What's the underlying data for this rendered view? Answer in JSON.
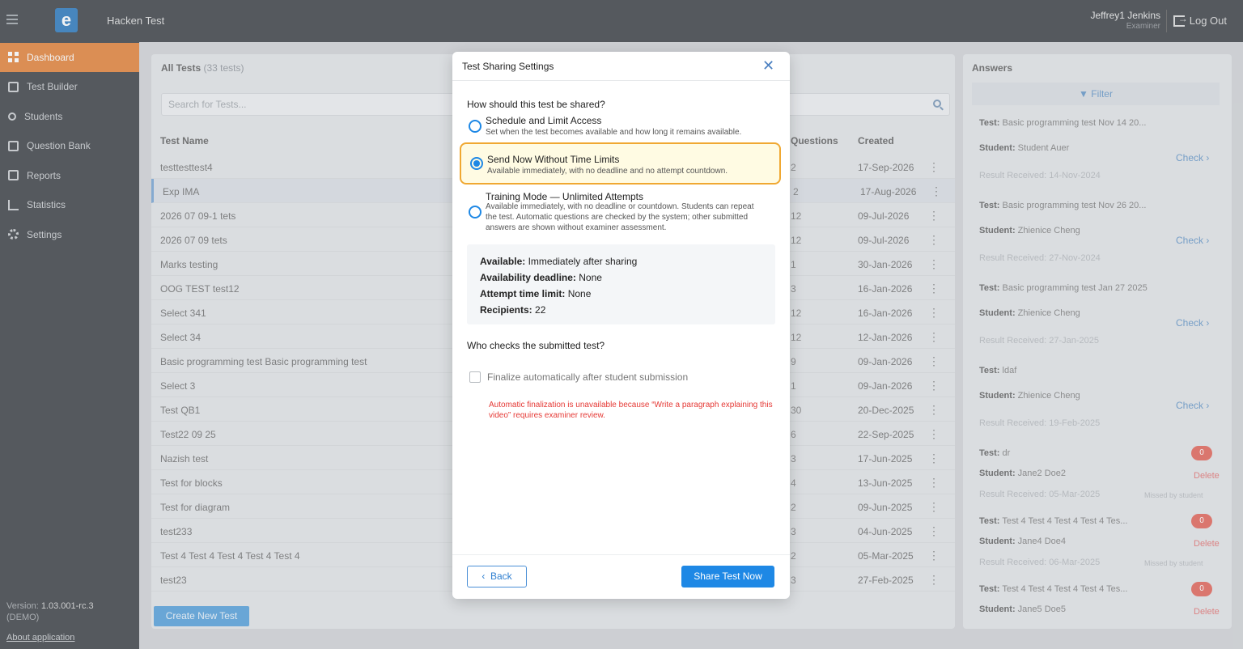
{
  "topbar": {
    "app_title": "Hacken Test",
    "logo_glyph": "e",
    "user_name": "Jeffrey1 Jenkins",
    "user_role": "Examiner",
    "logout_label": "Log Out"
  },
  "sidebar": {
    "items": [
      {
        "label": "Dashboard",
        "icon": "dashboard-icon"
      },
      {
        "label": "Test Builder",
        "icon": "builder-icon"
      },
      {
        "label": "Students",
        "icon": "students-icon"
      },
      {
        "label": "Question Bank",
        "icon": "question-bank-icon"
      },
      {
        "label": "Reports",
        "icon": "reports-icon"
      },
      {
        "label": "Statistics",
        "icon": "statistics-icon"
      },
      {
        "label": "Settings",
        "icon": "settings-icon"
      }
    ],
    "version_label": "Version:",
    "version": "1.03.001-rc.3",
    "env": "(DEMO)",
    "about": "About application"
  },
  "tests": {
    "title": "All Tests",
    "count": "(33 tests)",
    "search_placeholder": "Search for Tests...",
    "columns": {
      "name": "Test Name",
      "questions": "Questions",
      "created": "Created"
    },
    "rows": [
      {
        "name": "testtesttest4",
        "q": "2",
        "created": "17-Sep-2026"
      },
      {
        "name": "Exp IMA",
        "q": "2",
        "created": "17-Aug-2026"
      },
      {
        "name": "2026 07 09-1 tets",
        "q": "12",
        "created": "09-Jul-2026"
      },
      {
        "name": "2026 07 09 tets",
        "q": "12",
        "created": "09-Jul-2026"
      },
      {
        "name": "Marks testing",
        "q": "1",
        "created": "30-Jan-2026"
      },
      {
        "name": "OOG TEST test12",
        "q": "3",
        "created": "16-Jan-2026"
      },
      {
        "name": "Select 341",
        "q": "12",
        "created": "16-Jan-2026"
      },
      {
        "name": "Select 34",
        "q": "12",
        "created": "12-Jan-2026"
      },
      {
        "name": "Basic programming test Basic programming test",
        "q": "9",
        "created": "09-Jan-2026"
      },
      {
        "name": "Select 3",
        "q": "1",
        "created": "09-Jan-2026"
      },
      {
        "name": "Test QB1",
        "q": "30",
        "created": "20-Dec-2025"
      },
      {
        "name": "Test22 09 25",
        "q": "6",
        "created": "22-Sep-2025"
      },
      {
        "name": "Nazish test",
        "q": "3",
        "created": "17-Jun-2025"
      },
      {
        "name": "Test for blocks",
        "q": "4",
        "created": "13-Jun-2025"
      },
      {
        "name": "Test for diagram",
        "q": "2",
        "created": "09-Jun-2025"
      },
      {
        "name": "test233",
        "q": "3",
        "created": "04-Jun-2025"
      },
      {
        "name": "Test 4 Test 4 Test 4 Test 4 Test 4",
        "q": "2",
        "created": "05-Mar-2025"
      },
      {
        "name": "test23",
        "q": "3",
        "created": "27-Feb-2025"
      }
    ],
    "create_button": "Create New Test"
  },
  "answers": {
    "title": "Answers",
    "filter_label": "Filter",
    "test_label": "Test:",
    "student_label": "Student:",
    "check_label": "Check",
    "delete_label": "Delete",
    "missed_label": "Missed by student",
    "cards": [
      {
        "test": "Basic programming test Nov 14 20...",
        "student": "Student Auer",
        "received": "Result Received: 14-Nov-2024"
      },
      {
        "test": "Basic programming test Nov 26 20...",
        "student": "Zhienice Cheng",
        "received": "Result Received: 27-Nov-2024"
      },
      {
        "test": "Basic programming test Jan 27 2025",
        "student": "Zhienice Cheng",
        "received": "Result Received: 27-Jan-2025"
      },
      {
        "test": "ldaf",
        "student": "Zhienice Cheng",
        "received": "Result Received: 19-Feb-2025"
      },
      {
        "test": "dr",
        "student": "Jane2 Doe2",
        "received": "Result Received: 05-Mar-2025",
        "badge": "0"
      },
      {
        "test": "Test 4 Test 4 Test 4 Test 4 Tes...",
        "student": "Jane4 Doe4",
        "received": "Result Received: 06-Mar-2025",
        "badge": "0"
      },
      {
        "test": "Test 4 Test 4 Test 4 Test 4 Tes...",
        "student": "Jane5 Doe5",
        "badge": "0"
      }
    ]
  },
  "modal": {
    "title": "Test Sharing Settings",
    "question1": "How should this test be shared?",
    "options": [
      {
        "title": "Schedule and Limit Access",
        "desc": "Set when the test becomes available and how long it remains available."
      },
      {
        "title": "Send Now Without Time Limits",
        "desc": "Available immediately, with no deadline and no attempt countdown."
      },
      {
        "title": "Training Mode — Unlimited Attempts",
        "desc": "Available immediately, with no deadline or countdown. Students can repeat the test. Automatic questions are checked by the system; other submitted answers are shown without examiner assessment."
      }
    ],
    "summary": {
      "available_label": "Available:",
      "available_value": "Immediately after sharing",
      "deadline_label": "Availability deadline:",
      "deadline_value": "None",
      "time_label": "Attempt time limit:",
      "time_value": "None",
      "recipients_label": "Recipients:",
      "recipients_value": "22"
    },
    "question2": "Who checks the submitted test?",
    "finalize_label": "Finalize automatically after student submission",
    "warning": "Automatic finalization is unavailable because “Write a paragraph explaining this video” requires examiner review.",
    "back_label": "Back",
    "share_label": "Share Test Now"
  }
}
